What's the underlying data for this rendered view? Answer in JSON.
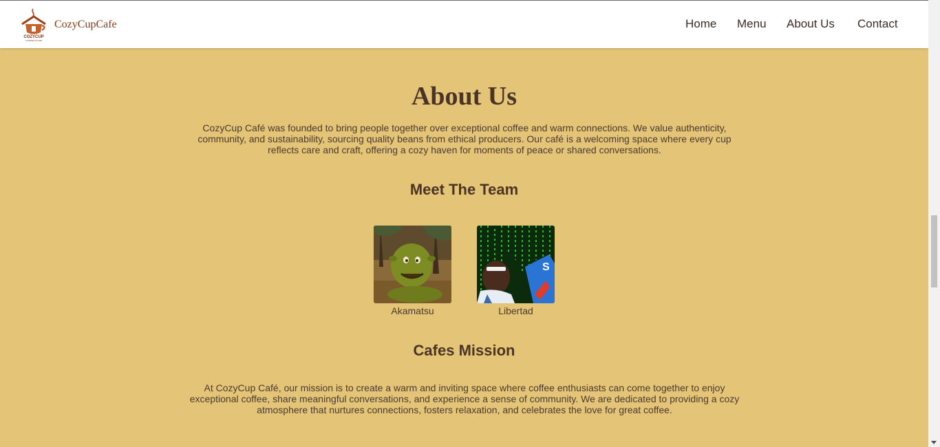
{
  "header": {
    "brand": "CozyCupCafe",
    "logo_text": "COZYCUP",
    "logo_subtext": "COFFEE HOUSE",
    "nav": [
      "Home",
      "Menu",
      "About Us",
      "Contact"
    ]
  },
  "about": {
    "title": "About Us",
    "intro": "CozyCup Café was founded to bring people together over exceptional coffee and warm connections. We value authenticity, community, and sustainability, sourcing quality beans from ethical producers. Our café is a welcoming space where every cup reflects care and craft, offering a cozy haven for moments of peace or shared conversations."
  },
  "team": {
    "heading": "Meet The Team",
    "members": [
      {
        "name": "Akamatsu"
      },
      {
        "name": "Libertad"
      }
    ]
  },
  "mission": {
    "heading": "Cafes Mission",
    "text": "At CozyCup Café, our mission is to create a warm and inviting space where coffee enthusiasts can come together to enjoy exceptional coffee, share meaningful conversations, and experience a sense of community. We are dedicated to providing a cozy atmosphere that nurtures connections, fosters relaxation, and celebrates the love for great coffee."
  },
  "colors": {
    "background": "#e4c476",
    "brand": "#8a3b13",
    "heading": "#4a3426"
  }
}
